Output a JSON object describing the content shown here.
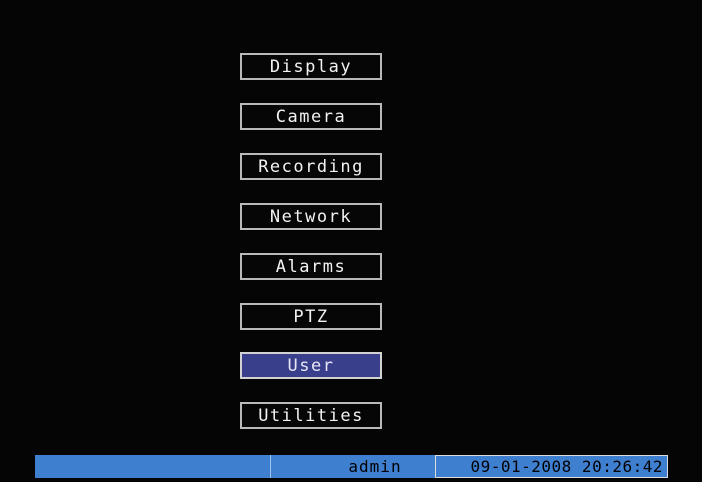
{
  "menu": {
    "items": [
      {
        "label": "Display"
      },
      {
        "label": "Camera"
      },
      {
        "label": "Recording"
      },
      {
        "label": "Network"
      },
      {
        "label": "Alarms"
      },
      {
        "label": "PTZ"
      },
      {
        "label": "User",
        "selected": true
      },
      {
        "label": "Utilities"
      }
    ]
  },
  "status_bar": {
    "user": "admin",
    "datetime": "09-01-2008 20:26:42"
  },
  "colors": {
    "background": "#050505",
    "menu_border": "#b9b9b9",
    "selected_fill": "#3a3f8c",
    "status_bar": "#3f7fd0"
  }
}
